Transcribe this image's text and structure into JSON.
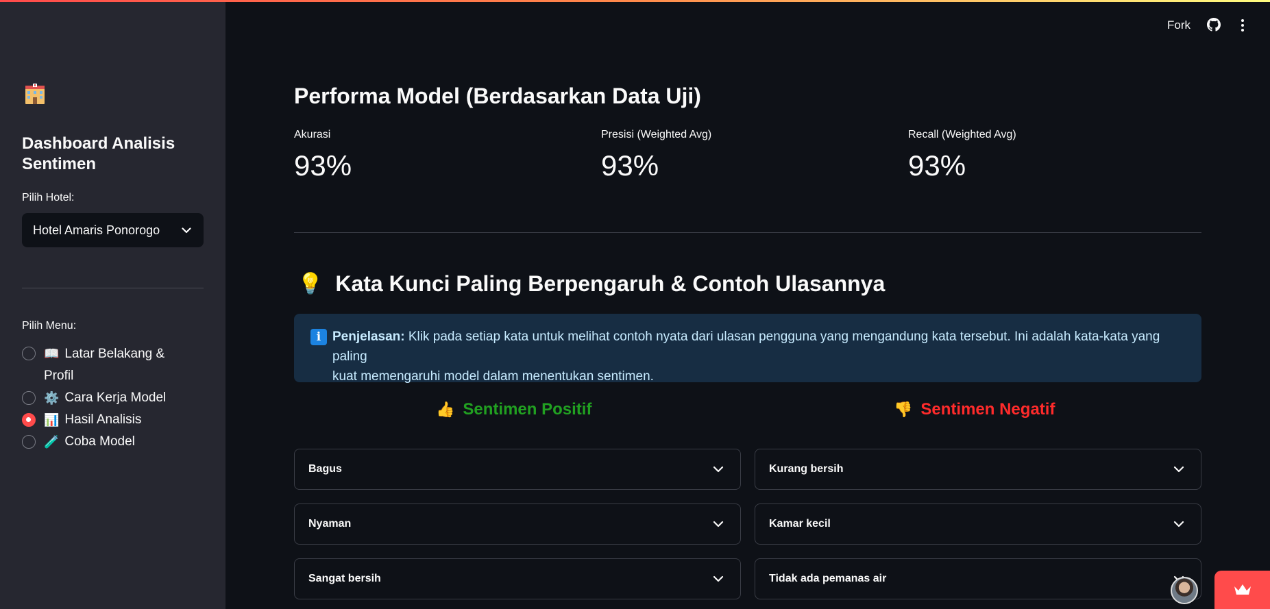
{
  "sidebar": {
    "logo_icon": "hotel-icon",
    "title": "Dashboard Analisis Sentimen",
    "hotel_label": "Pilih Hotel:",
    "hotel_selected": "Hotel Amaris Ponorogo",
    "menu_label": "Pilih Menu:",
    "menu_items": [
      {
        "emoji": "📖",
        "label": "Latar Belakang &",
        "label2": "Profil",
        "checked": false
      },
      {
        "emoji": "⚙️",
        "label": "Cara Kerja Model",
        "checked": false
      },
      {
        "emoji": "📊",
        "label": "Hasil Analisis",
        "checked": true
      },
      {
        "emoji": "🧪",
        "label": "Coba Model",
        "checked": false
      }
    ]
  },
  "header": {
    "fork_label": "Fork",
    "github_icon": "github-icon",
    "menu_icon": "vertical-dots-icon"
  },
  "performance": {
    "title": "Performa Model (Berdasarkan Data Uji)",
    "metrics": [
      {
        "label": "Akurasi",
        "value": "93%"
      },
      {
        "label": "Presisi (Weighted Avg)",
        "value": "93%"
      },
      {
        "label": "Recall (Weighted Avg)",
        "value": "93%"
      }
    ]
  },
  "keywords": {
    "bulb": "💡",
    "title": "Kata Kunci Paling Berpengaruh & Contoh Ulasannya",
    "info_bold": "Penjelasan:",
    "info_line1": " Klik pada setiap kata untuk melihat contoh nyata dari ulasan pengguna yang mengandung kata tersebut. Ini adalah kata-kata yang paling",
    "info_line2": "kuat memengaruhi model dalam menentukan sentimen.",
    "positive_emoji": "👍",
    "positive_title": "Sentimen Positif",
    "negative_emoji": "👎",
    "negative_title": "Sentimen Negatif",
    "positive_items": [
      "Bagus",
      "Nyaman",
      "Sangat bersih"
    ],
    "negative_items": [
      "Kurang bersih",
      "Kamar kecil",
      "Tidak ada pemanas air"
    ]
  },
  "colors": {
    "accent": "#ff4b4b",
    "positive": "#21a021",
    "negative": "#ff2b2b",
    "info_bg": "#172d43"
  }
}
